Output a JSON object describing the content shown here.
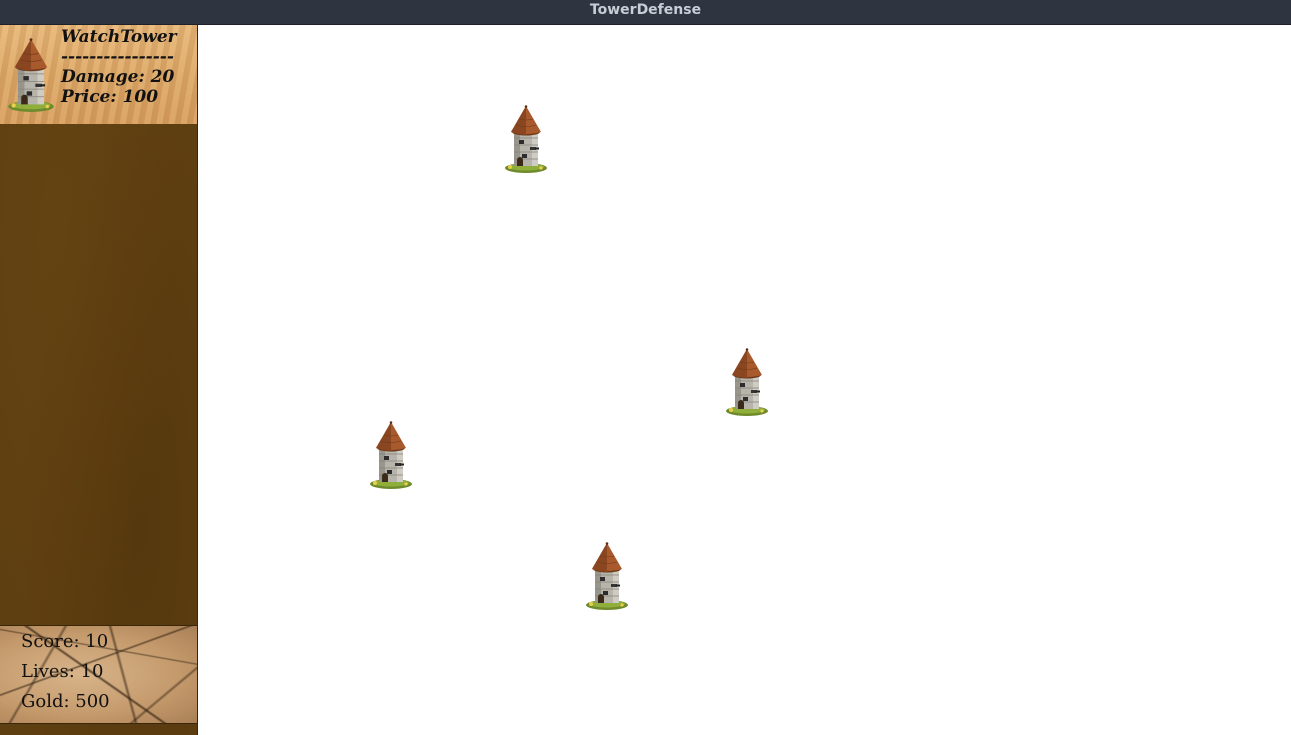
{
  "window": {
    "title": "TowerDefense"
  },
  "shop": {
    "tower_name": "WatchTower",
    "separator": "----------------",
    "damage_text": "Damage: 20",
    "price_text": "Price: 100",
    "tower_icon": "watch-tower-icon"
  },
  "stats": {
    "score_text": "Score: 10",
    "lives_text": "Lives: 10",
    "gold_text": "Gold: 500"
  },
  "field": {
    "placed_towers": [
      {
        "type": "WatchTower"
      },
      {
        "type": "WatchTower"
      },
      {
        "type": "WatchTower"
      },
      {
        "type": "WatchTower"
      }
    ]
  },
  "colors": {
    "titlebar": "#2f3441",
    "sidebar": "#5e3f11",
    "roof": "#a85a2c",
    "stone": "#b9b6ad"
  }
}
